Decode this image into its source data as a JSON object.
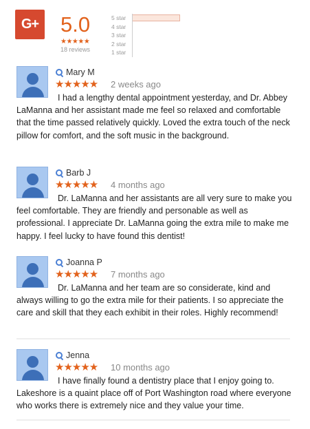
{
  "summary": {
    "logo_text": "G+",
    "rating": "5.0",
    "stars": "★★★★★",
    "review_count": "18 reviews",
    "distribution": [
      {
        "label": "5 star",
        "fraction": 1.0
      },
      {
        "label": "4 star",
        "fraction": 0
      },
      {
        "label": "3 star",
        "fraction": 0
      },
      {
        "label": "2 star",
        "fraction": 0
      },
      {
        "label": "1 star",
        "fraction": 0
      }
    ],
    "accent_color": "#e2621c",
    "logo_color": "#d6492f"
  },
  "reviews": [
    {
      "name": "Mary M",
      "stars": "★★★★★",
      "date": "2 weeks ago",
      "text": "I had a lengthy dental appointment yesterday, and Dr. Abbey LaManna and her assistant made me feel so relaxed and comfortable that the time passed relatively quickly. Loved the extra touch of the neck pillow for comfort, and the soft music in the background."
    },
    {
      "name": "Barb J",
      "stars": "★★★★★",
      "date": "4 months ago",
      "text": "Dr. LaManna and her assistants are all very sure to make you feel comfortable. They are friendly and personable as well as professional. I appreciate Dr. LaManna going the extra mile to make me happy. I feel lucky to have found this dentist!"
    },
    {
      "name": "Joanna P",
      "stars": "★★★★★",
      "date": "7 months ago",
      "text": "Dr. LaManna and her team are so considerate, kind and always willing to go the extra mile for their patients. I so appreciate the care and skill that they each exhibit in their roles. Highly recommend!"
    },
    {
      "name": "Jenna",
      "stars": "★★★★★",
      "date": "10 months ago",
      "text": "I have finally found a dentistry place that I enjoy going to. Lakeshore is a quaint place off of Port Washington road where everyone who works there is extremely nice and they value your time."
    }
  ]
}
